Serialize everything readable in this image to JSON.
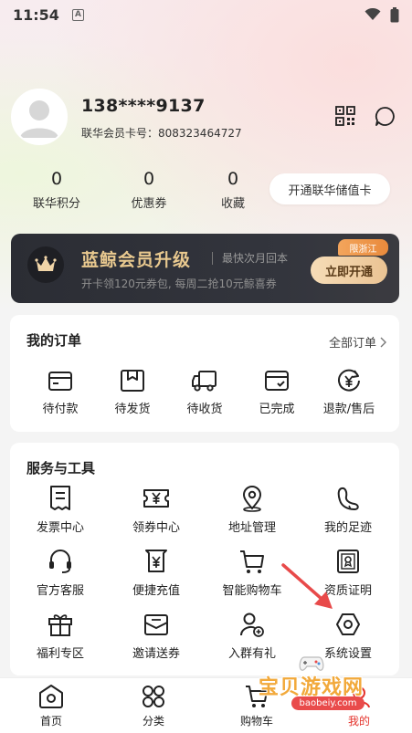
{
  "status_bar": {
    "time": "11:54",
    "a_badge": "A",
    "wifi_icon": "wifi-icon",
    "battery_icon": "battery-icon"
  },
  "profile": {
    "phone": "138****9137",
    "member_card": "联华会员卡号：808323464727",
    "qr_icon": "qr-code-icon",
    "message_icon": "message-icon"
  },
  "stats": [
    {
      "value": "0",
      "label": "联华积分"
    },
    {
      "value": "0",
      "label": "优惠券"
    },
    {
      "value": "0",
      "label": "收藏"
    }
  ],
  "value_card_button": "开通联华储值卡",
  "vip_banner": {
    "title": "蓝鲸会员升级",
    "subtitle": "最快次月回本",
    "description": "开卡领120元券包, 每周二抢10元鲸喜券",
    "tag": "限浙江",
    "button": "立即开通",
    "title_color": "#e9c98f"
  },
  "orders": {
    "title": "我的订单",
    "more": "全部订单",
    "items": [
      {
        "label": "待付款",
        "icon": "wallet-icon"
      },
      {
        "label": "待发货",
        "icon": "package-icon"
      },
      {
        "label": "待收货",
        "icon": "truck-icon"
      },
      {
        "label": "已完成",
        "icon": "completed-card-icon"
      },
      {
        "label": "退款/售后",
        "icon": "refund-icon"
      }
    ]
  },
  "services": {
    "title": "服务与工具",
    "items": [
      {
        "label": "发票中心",
        "icon": "invoice-icon"
      },
      {
        "label": "领券中心",
        "icon": "coupon-icon"
      },
      {
        "label": "地址管理",
        "icon": "location-icon"
      },
      {
        "label": "我的足迹",
        "icon": "footprint-icon"
      },
      {
        "label": "官方客服",
        "icon": "headset-icon"
      },
      {
        "label": "便捷充值",
        "icon": "recharge-icon"
      },
      {
        "label": "智能购物车",
        "icon": "cart-icon"
      },
      {
        "label": "资质证明",
        "icon": "certificate-icon"
      },
      {
        "label": "福利专区",
        "icon": "gift-icon"
      },
      {
        "label": "邀请送券",
        "icon": "envelope-icon"
      },
      {
        "label": "入群有礼",
        "icon": "add-user-icon"
      },
      {
        "label": "系统设置",
        "icon": "settings-icon"
      }
    ]
  },
  "bottom_nav": [
    {
      "label": "首页",
      "icon": "home-icon"
    },
    {
      "label": "分类",
      "icon": "category-icon"
    },
    {
      "label": "购物车",
      "icon": "cart-icon"
    },
    {
      "label": "我的",
      "icon": "profile-icon",
      "active": true
    }
  ],
  "watermark": {
    "text": "宝贝游戏网",
    "url": "baobeiy.com"
  },
  "colors": {
    "accent_red": "#e4322b",
    "gold": "#e9c98f",
    "dark_banner": "#2b2d34"
  }
}
